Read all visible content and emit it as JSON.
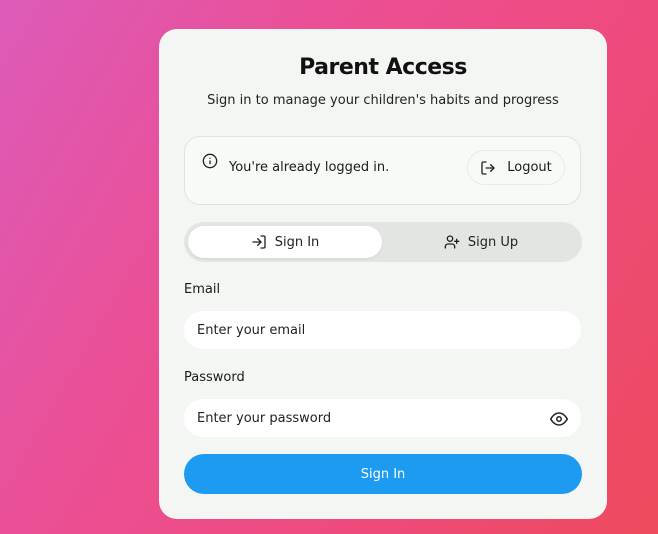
{
  "header": {
    "title": "Parent Access",
    "subtitle": "Sign in to manage your children's habits and progress"
  },
  "status": {
    "message": "You're already logged in.",
    "icon": "info-icon",
    "logout_label": "Logout",
    "logout_icon": "logout-icon"
  },
  "tabs": [
    {
      "label": "Sign In",
      "icon": "sign-in-icon",
      "active": true
    },
    {
      "label": "Sign Up",
      "icon": "user-plus-icon",
      "active": false
    }
  ],
  "form": {
    "email_label": "Email",
    "email_placeholder": "Enter your email",
    "email_value": "",
    "password_label": "Password",
    "password_placeholder": "Enter your password",
    "password_value": "",
    "password_toggle_icon": "eye-icon",
    "submit_label": "Sign In"
  },
  "colors": {
    "primary": "#1d9bf0",
    "card_background": "#f4f6f4",
    "background_gradient_start": "#dc5bb9",
    "background_gradient_end": "#ee4a5c"
  }
}
